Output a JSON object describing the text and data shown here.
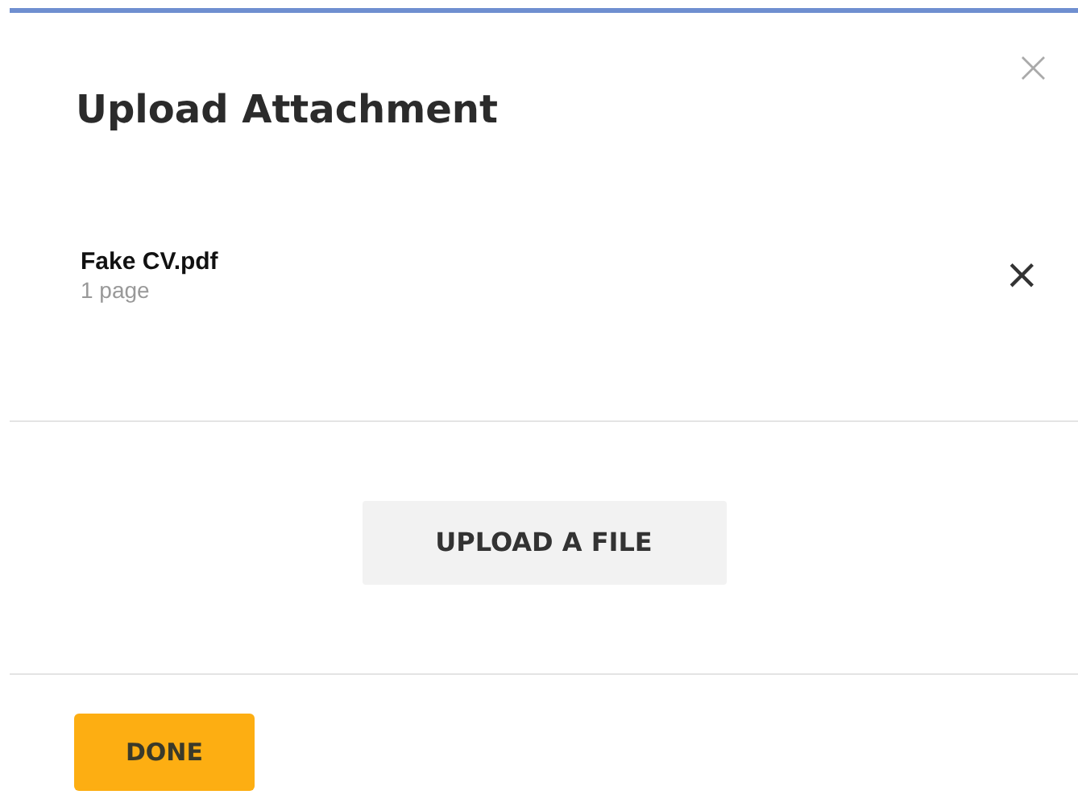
{
  "dialog": {
    "title": "Upload Attachment",
    "close": "×"
  },
  "files": [
    {
      "name": "Fake CV.pdf",
      "pages": "1 page",
      "remove": "×"
    }
  ],
  "upload_button": "UPLOAD A FILE",
  "done_button": "DONE"
}
